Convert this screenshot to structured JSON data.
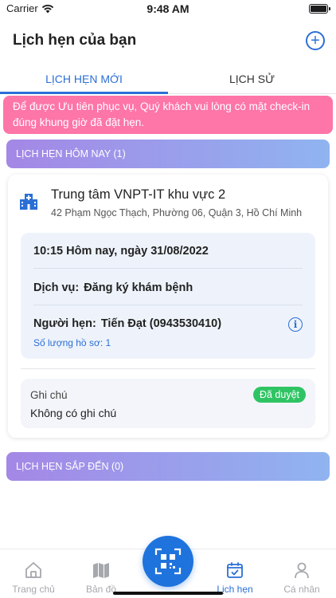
{
  "status_bar": {
    "carrier": "Carrier",
    "time": "9:48 AM"
  },
  "header": {
    "title": "Lịch hẹn của bạn",
    "add_icon": "plus-circle-icon"
  },
  "tabs": [
    {
      "label": "LỊCH HẸN MỚI",
      "active": true
    },
    {
      "label": "LỊCH SỬ",
      "active": false
    }
  ],
  "notice": {
    "text": "Để được Ưu tiên phục vụ, Quý khách vui lòng có mặt check-in đúng khung giờ đã đặt hẹn."
  },
  "sections": {
    "today": "LỊCH HẸN HÔM NAY (1)",
    "upcoming": "LỊCH HẸN SẮP ĐẾN (0)"
  },
  "appointment": {
    "center_name": "Trung tâm VNPT-IT khu vực 2",
    "address": "42 Phạm Ngọc Thạch, Phường 06, Quận 3, Hồ Chí Minh",
    "datetime": "10:15 Hôm nay, ngày 31/08/2022",
    "service_label": "Dịch vụ:",
    "service": "Đăng ký khám bệnh",
    "person_label": "Người hẹn:",
    "person": "Tiến Đạt (0943530410)",
    "record_count": "Số lượng hồ sơ: 1",
    "note_label": "Ghi chú",
    "note": "Không có ghi chú",
    "status": "Đã duyệt"
  },
  "bottom_nav": [
    {
      "label": "Trang chủ",
      "icon": "home-icon",
      "active": false
    },
    {
      "label": "Bản đồ",
      "icon": "map-icon",
      "active": false
    },
    {
      "label": "Lịch hẹn",
      "icon": "calendar-check-icon",
      "active": true
    },
    {
      "label": "Cá nhân",
      "icon": "person-icon",
      "active": false
    }
  ],
  "colors": {
    "primary": "#2b6fd6",
    "notice_bg": "#fe75a8",
    "status_green": "#2fc463"
  }
}
